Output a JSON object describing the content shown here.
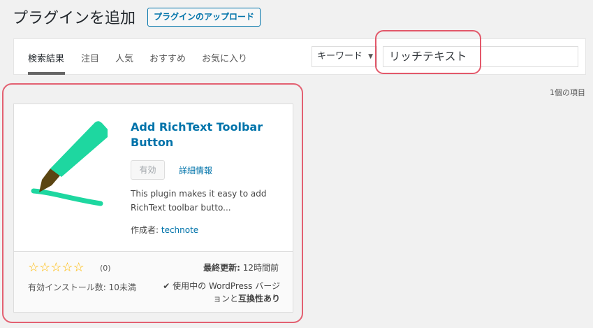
{
  "header": {
    "title": "プラグインを追加",
    "upload_label": "プラグインのアップロード"
  },
  "tabs": [
    {
      "label": "検索結果"
    },
    {
      "label": "注目"
    },
    {
      "label": "人気"
    },
    {
      "label": "おすすめ"
    },
    {
      "label": "お気に入り"
    }
  ],
  "search": {
    "type_label": "キーワード",
    "value": "リッチテキスト"
  },
  "result_count": "1個の項目",
  "plugin": {
    "name": "Add RichText Toolbar Button",
    "active_label": "有効",
    "details_label": "詳細情報",
    "description": "This plugin makes it easy to add RichText toolbar butto...",
    "author_prefix": "作成者: ",
    "author": "technote",
    "rating_count": "(0)",
    "installs": "有効インストール数: 10未満",
    "last_updated_label": "最終更新:",
    "last_updated_value": "12時間前",
    "compat_check": "✔",
    "compat_text": "使用中の WordPress バージョンと",
    "compat_bold": "互換性あり"
  },
  "colors": {
    "link": "#0073aa",
    "marker": "#1ed7a0",
    "annotation": "#e0465a",
    "star": "#ffb900"
  }
}
